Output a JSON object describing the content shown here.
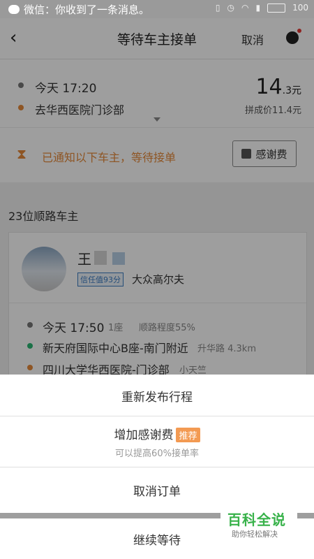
{
  "status_bar": {
    "notification": "微信：你收到了一条消息。",
    "battery": "100"
  },
  "header": {
    "title": "等待车主接单",
    "cancel_label": "取消"
  },
  "trip": {
    "time": "今天 17:20",
    "destination": "去华西医院门诊部",
    "price_int": "14",
    "price_dec": ".3元",
    "pool_price": "拼成价11.4元",
    "notify_text": "已通知以下车主，等待接单",
    "thanks_button": "感谢费"
  },
  "drivers": {
    "count_label": "23位顺路车主",
    "card": {
      "name": "王",
      "trust": "信任值93分",
      "car": "大众高尔夫",
      "time": "今天 17:50",
      "seats": "1座",
      "match": "顺路程度55%",
      "from": "新天府国际中心B座-南门附近",
      "from_sub": "升华路 4.3km",
      "to": "四川大学华西医院-门诊部",
      "to_sub": "小天竺"
    }
  },
  "sheet": {
    "republish": "重新发布行程",
    "add_tip": "增加感谢费",
    "recommend": "推荐",
    "add_tip_sub": "可以提高60%接单率",
    "cancel_order": "取消订单",
    "keep_waiting": "继续等待"
  },
  "watermark": {
    "title": "百科全说",
    "subtitle": "助你轻松解决"
  },
  "colors": {
    "accent_orange": "#e58a3a",
    "dot_green": "#2bb673",
    "trust_blue": "#3d7cc2",
    "watermark_green": "#38b24a"
  }
}
